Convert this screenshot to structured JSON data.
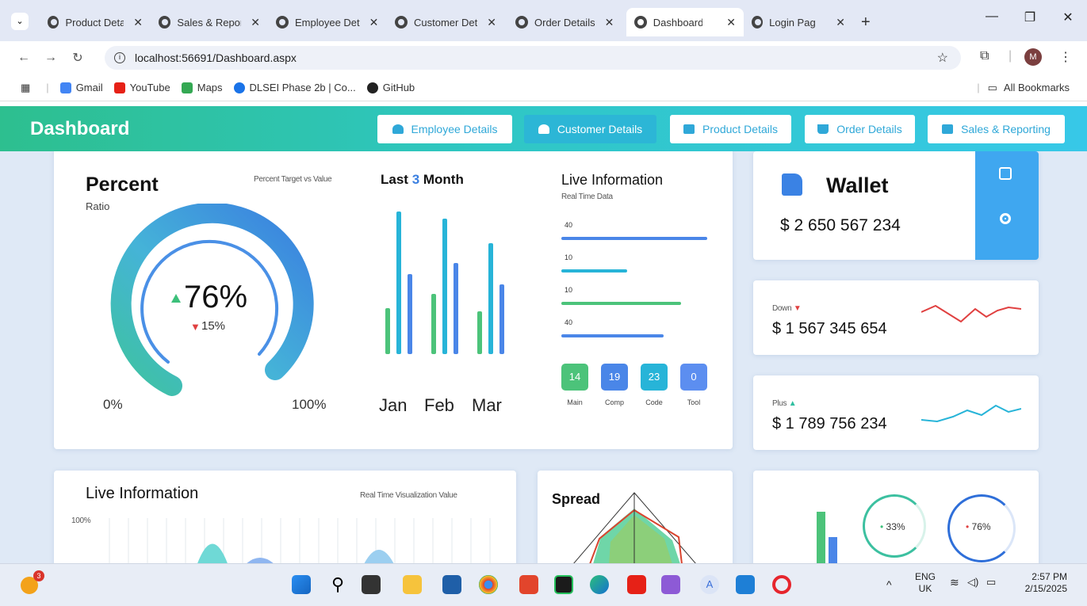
{
  "browser": {
    "tabs": [
      {
        "title": "Product Detail"
      },
      {
        "title": "Sales & Repor"
      },
      {
        "title": "Employee Det"
      },
      {
        "title": "Customer Det"
      },
      {
        "title": "Order Details"
      },
      {
        "title": "Dashboard"
      },
      {
        "title": "Login Page"
      }
    ],
    "url": "localhost:56691/Dashboard.aspx",
    "profile_initial": "M",
    "bookmarks": [
      "Gmail",
      "YouTube",
      "Maps",
      "DLSEI Phase 2b | Co...",
      "GitHub"
    ],
    "all_bookmarks": "All Bookmarks"
  },
  "header": {
    "title": "Dashboard",
    "buttons": [
      {
        "label": "Employee Details"
      },
      {
        "label": "Customer Details"
      },
      {
        "label": "Product Details"
      },
      {
        "label": "Order Details"
      },
      {
        "label": "Sales & Reporting"
      }
    ]
  },
  "percent_card": {
    "title": "Percent",
    "subtitle": "Ratio",
    "caption": "Percent Target vs Value",
    "value": "76%",
    "delta": "15%",
    "min_label": "0%",
    "max_label": "100%",
    "fill_fraction": 0.76
  },
  "month_card": {
    "title_prefix": "Last ",
    "title_num": "3",
    "title_suffix": " Month",
    "months": [
      "Jan",
      "Feb",
      "Mar"
    ],
    "bars": [
      {
        "green": 0.32,
        "teal": 1.0,
        "blue": 0.56
      },
      {
        "green": 0.42,
        "teal": 0.95,
        "blue": 0.64
      },
      {
        "green": 0.3,
        "teal": 0.78,
        "blue": 0.49
      }
    ]
  },
  "live_card": {
    "title": "Live Information",
    "caption": "Real Time Data",
    "rows": [
      {
        "label": "40",
        "fill": 1.0,
        "color": "#4a86e8"
      },
      {
        "label": "10",
        "fill": 0.45,
        "color": "#27b4d8"
      },
      {
        "label": "10",
        "fill": 0.82,
        "color": "#4cc37a"
      },
      {
        "label": "40",
        "fill": 0.7,
        "color": "#4a86e8"
      }
    ],
    "badges": [
      {
        "value": "14",
        "label": "Main",
        "color": "#4cc37a"
      },
      {
        "value": "19",
        "label": "Comp",
        "color": "#4a86e8"
      },
      {
        "value": "23",
        "label": "Code",
        "color": "#27b4d8"
      },
      {
        "value": "0",
        "label": "Tool",
        "color": "#5c8ef0"
      }
    ]
  },
  "wallet_card": {
    "title": "Wallet",
    "amount": "$ 2 650 567 234"
  },
  "stat1": {
    "label": "Down",
    "amount": "$ 1 567 345 654"
  },
  "stat2": {
    "label": "Plus",
    "amount": "$ 1 789 756 234"
  },
  "live2": {
    "title": "Live Information",
    "caption": "Real Time Visualization Value",
    "axis": "100%"
  },
  "spread": {
    "title": "Spread"
  },
  "rings": {
    "left": "33%",
    "right": "76%"
  },
  "clock": {
    "lang": "ENG",
    "region": "UK",
    "time": "2:57 PM",
    "date": "2/15/2025",
    "badge": "3"
  }
}
